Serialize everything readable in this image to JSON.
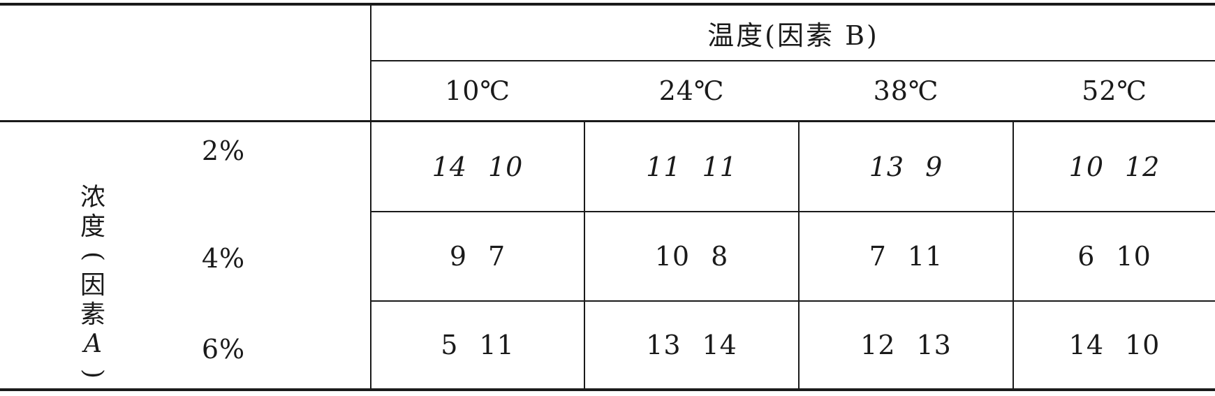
{
  "column_header": {
    "title": "温度(因素 B)",
    "temperatures": [
      "10℃",
      "24℃",
      "38℃",
      "52℃"
    ]
  },
  "row_header": {
    "title": "浓度(因素A)",
    "title_chars": [
      "浓",
      "度",
      "(",
      "因",
      "素",
      "A",
      ")"
    ],
    "concentrations": [
      "2%",
      "4%",
      "6%"
    ]
  },
  "rows": [
    {
      "cells": [
        [
          "14",
          "10"
        ],
        [
          "11",
          "11"
        ],
        [
          "13",
          "9"
        ],
        [
          "10",
          "12"
        ]
      ]
    },
    {
      "cells": [
        [
          "9",
          "7"
        ],
        [
          "10",
          "8"
        ],
        [
          "7",
          "11"
        ],
        [
          "6",
          "10"
        ]
      ]
    },
    {
      "cells": [
        [
          "5",
          "11"
        ],
        [
          "13",
          "14"
        ],
        [
          "12",
          "13"
        ],
        [
          "14",
          "10"
        ]
      ]
    }
  ]
}
